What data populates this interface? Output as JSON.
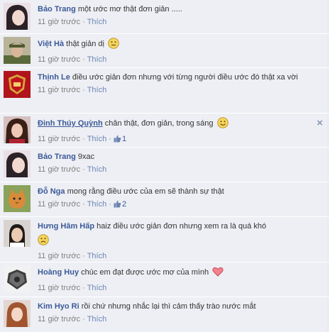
{
  "comments": [
    {
      "author": "Bảo Trang",
      "text": "một ước mơ thật đơn giản .....",
      "time": "11 giờ trước",
      "like": "Thích"
    },
    {
      "author": "Việt Hà",
      "text": "thật giản dị",
      "time": "11 giờ trước",
      "like": "Thích"
    },
    {
      "author": "Thịnh Le",
      "text": "điều ước giản đơn nhưng với từng người điều ước đó thật xa vời",
      "time": "11 giờ trước",
      "like": "Thích"
    },
    {
      "author": "Đinh Thúy Quỳnh",
      "text": "chân thật, đơn giản, trong sáng",
      "time": "11 giờ trước",
      "like": "Thích",
      "likes": "1",
      "close": "×"
    },
    {
      "author": "Bảo Trang",
      "text": "9xac",
      "time": "11 giờ trước",
      "like": "Thích"
    },
    {
      "author": "Đỗ Nga",
      "text": "mong rằng điều ước của em sẽ thành sự thật",
      "time": "11 giờ trước",
      "like": "Thích",
      "likes": "2"
    },
    {
      "author": "Hưng Hâm Hấp",
      "text": "haiz điều ước giản đơn nhưng xem ra là quá khó",
      "time": "11 giờ trước",
      "like": "Thích"
    },
    {
      "author": "Hoàng Huy",
      "text": "chúc em đạt được ước mơ của mình",
      "time": "11 giờ trước",
      "like": "Thích"
    },
    {
      "author": "Kim Hyo Ri",
      "text": "rồi chứ nhưng nhắc lại thì cảm thấy trào nước mắt",
      "time": "11 giờ trước",
      "like": "Thích"
    }
  ],
  "separator": "·",
  "colors": {
    "background": "#edeff4",
    "link": "#3b5998",
    "meta": "#808080"
  }
}
